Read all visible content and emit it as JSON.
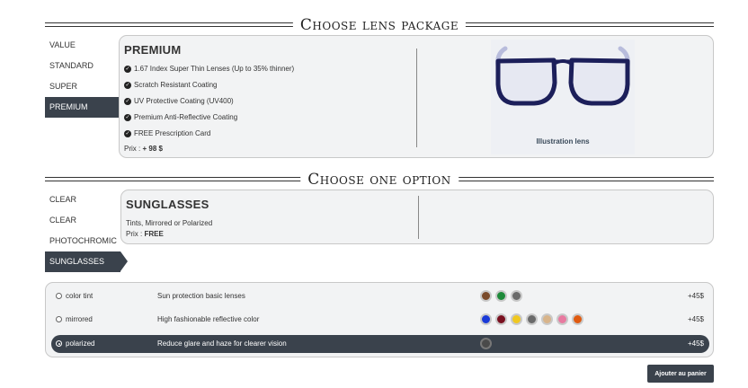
{
  "section1": {
    "title": "Choose lens package"
  },
  "packages": [
    "VALUE",
    "STANDARD",
    "SUPER",
    "PREMIUM"
  ],
  "package_panel": {
    "title": "PREMIUM",
    "features": [
      "1.67 Index Super Thin Lenses (Up to 35% thinner)",
      "Scratch Resistant Coating",
      "UV Protective Coating (UV400)",
      "Premium Anti-Reflective Coating",
      "FREE Prescription Card"
    ],
    "price_label": "Prix :",
    "price_value": "+ 98 $",
    "illustration_label": "Illustration lens"
  },
  "section2": {
    "title": "Choose one option"
  },
  "lens_types": [
    "CLEAR",
    "CLEAR",
    "PHOTOCHROMIC",
    "SUNGLASSES"
  ],
  "option_panel": {
    "title": "SUNGLASSES",
    "description": "Tints, Mirrored or Polarized",
    "price_label": "Prix :",
    "price_value": "FREE"
  },
  "sun_options": [
    {
      "name": "color tint",
      "description": "Sun protection basic lenses",
      "price": "+45$",
      "swatches": [
        "#7a4a2a",
        "#1e8a3a",
        "#6a6a6a"
      ]
    },
    {
      "name": "mirrored",
      "description": "High fashionable reflective color",
      "price": "+45$",
      "swatches": [
        "#1a3ad8",
        "#7a1020",
        "#f0c820",
        "#6a6a6a",
        "#d8b48a",
        "#e87aa0",
        "#e05a10"
      ]
    },
    {
      "name": "polarized",
      "description": "Reduce glare and haze for clearer vision",
      "price": "+45$",
      "swatches": [
        "#4a4a4a"
      ]
    }
  ],
  "cart_button": "Ajouter au panier",
  "colors": {
    "accent_dark": "#3a424c",
    "panel_bg": "#f2f3f4",
    "frame_blue": "#1c1f5a",
    "temple_lavender": "#b8bcdc"
  }
}
